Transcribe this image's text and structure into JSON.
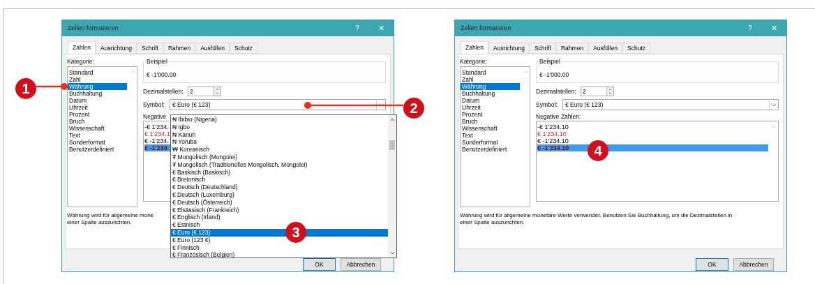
{
  "dialogs": [
    {
      "title": "Zellen formatieren",
      "help": "?",
      "close": "✕",
      "tabs": [
        {
          "label": "Zahlen",
          "selected": true
        },
        {
          "label": "Ausrichtung",
          "selected": false
        },
        {
          "label": "Schrift",
          "selected": false
        },
        {
          "label": "Rahmen",
          "selected": false
        },
        {
          "label": "Ausfüllen",
          "selected": false
        },
        {
          "label": "Schutz",
          "selected": false
        }
      ],
      "category_label": "Kategorie:",
      "categories": [
        {
          "label": "Standard",
          "selected": false
        },
        {
          "label": "Zahl",
          "selected": false
        },
        {
          "label": "Währung",
          "selected": true
        },
        {
          "label": "Buchhaltung",
          "selected": false
        },
        {
          "label": "Datum",
          "selected": false
        },
        {
          "label": "Uhrzeit",
          "selected": false
        },
        {
          "label": "Prozent",
          "selected": false
        },
        {
          "label": "Bruch",
          "selected": false
        },
        {
          "label": "Wissenschaft",
          "selected": false
        },
        {
          "label": "Text",
          "selected": false
        },
        {
          "label": "Sonderformat",
          "selected": false
        },
        {
          "label": "Benutzerdefiniert",
          "selected": false
        }
      ],
      "sample_label": "Beispiel",
      "sample_value": "€ -1'000.00",
      "decimals_label": "Dezimalstellen:",
      "decimals_value": "2",
      "symbol_label": "Symbol:",
      "symbol_value": "€ Euro (€ 123)",
      "negative_label": "Negative",
      "negative_numbers": [
        {
          "text": "-€ 1'234.",
          "red": false,
          "selected": false
        },
        {
          "text": "€ 1'234.1",
          "red": true,
          "selected": false
        },
        {
          "text": "€ -1'234.",
          "red": false,
          "selected": false
        },
        {
          "text": "€ -1'234",
          "red": true,
          "selected": true
        }
      ],
      "description_lines": [
        "Währung wird für allgemeine mone",
        "einer Spalte auszurichten."
      ],
      "buttons": [
        {
          "label": "OK",
          "default": true
        },
        {
          "label": "Abbrechen",
          "default": false
        }
      ],
      "dropdown": [
        {
          "label": "₦ Ibibio (Nigeria)",
          "selected": false
        },
        {
          "label": "₦ Igbo",
          "selected": false
        },
        {
          "label": "₦ Kanuri",
          "selected": false
        },
        {
          "label": "₦ Yoruba",
          "selected": false
        },
        {
          "label": "₩ Koreanisch",
          "selected": false
        },
        {
          "label": "₮ Mongolisch (Mongolei)",
          "selected": false
        },
        {
          "label": "₮ Mongolisch (Traditionelles Mongolisch, Mongolei)",
          "selected": false
        },
        {
          "label": "€ Baskisch (Baskisch)",
          "selected": false
        },
        {
          "label": "€ Bretonisch",
          "selected": false
        },
        {
          "label": "€ Deutsch (Deutschland)",
          "selected": false
        },
        {
          "label": "€ Deutsch (Luxemburg)",
          "selected": false
        },
        {
          "label": "€ Deutsch (Österreich)",
          "selected": false
        },
        {
          "label": "€ Elsässisch (Frankreich)",
          "selected": false
        },
        {
          "label": "€ Englisch (Irland)",
          "selected": false
        },
        {
          "label": "€ Estnisch",
          "selected": false
        },
        {
          "label": "€ Euro (€ 123)",
          "selected": true
        },
        {
          "label": "€ Euro (123 €)",
          "selected": false
        },
        {
          "label": "€ Finnisch",
          "selected": false
        },
        {
          "label": "€ Französisch (Belgien)",
          "selected": false
        }
      ]
    },
    {
      "title": "Zellen formatieren",
      "help": "?",
      "close": "✕",
      "tabs": [
        {
          "label": "Zahlen",
          "selected": true
        },
        {
          "label": "Ausrichtung",
          "selected": false
        },
        {
          "label": "Schrift",
          "selected": false
        },
        {
          "label": "Rahmen",
          "selected": false
        },
        {
          "label": "Ausfüllen",
          "selected": false
        },
        {
          "label": "Schutz",
          "selected": false
        }
      ],
      "category_label": "Kategorie:",
      "categories": [
        {
          "label": "Standard",
          "selected": false
        },
        {
          "label": "Zahl",
          "selected": false
        },
        {
          "label": "Währung",
          "selected": true
        },
        {
          "label": "Buchhaltung",
          "selected": false
        },
        {
          "label": "Datum",
          "selected": false
        },
        {
          "label": "Uhrzeit",
          "selected": false
        },
        {
          "label": "Prozent",
          "selected": false
        },
        {
          "label": "Bruch",
          "selected": false
        },
        {
          "label": "Wissenschaft",
          "selected": false
        },
        {
          "label": "Text",
          "selected": false
        },
        {
          "label": "Sonderformat",
          "selected": false
        },
        {
          "label": "Benutzerdefiniert",
          "selected": false
        }
      ],
      "sample_label": "Beispiel",
      "sample_value": "€ -1'000.00",
      "decimals_label": "Dezimalstellen:",
      "decimals_value": "2",
      "symbol_label": "Symbol:",
      "symbol_value": "€ Euro (€ 123)",
      "negative_label": "Negative Zahlen:",
      "negative_numbers": [
        {
          "text": "-€ 1'234.10",
          "red": false,
          "selected": false
        },
        {
          "text": "€ 1'234.10",
          "red": true,
          "selected": false
        },
        {
          "text": "€ -1'234.10",
          "red": false,
          "selected": false
        },
        {
          "text": "€ -1'234.10",
          "red": true,
          "selected": true
        }
      ],
      "description_lines": [
        "Währung wird für allgemeine monetäre Werte verwendet. Benutzen Sie Buchhaltung, um die Dezimalstellen in",
        "einer Spalte auszurichten."
      ],
      "buttons": [
        {
          "label": "OK",
          "default": true
        },
        {
          "label": "Abbrechen",
          "default": false
        }
      ]
    }
  ],
  "callouts": [
    {
      "number": "1",
      "leader": true
    },
    {
      "number": "2",
      "leader": true
    },
    {
      "number": "3",
      "leader": false
    },
    {
      "number": "4",
      "leader": false
    }
  ]
}
